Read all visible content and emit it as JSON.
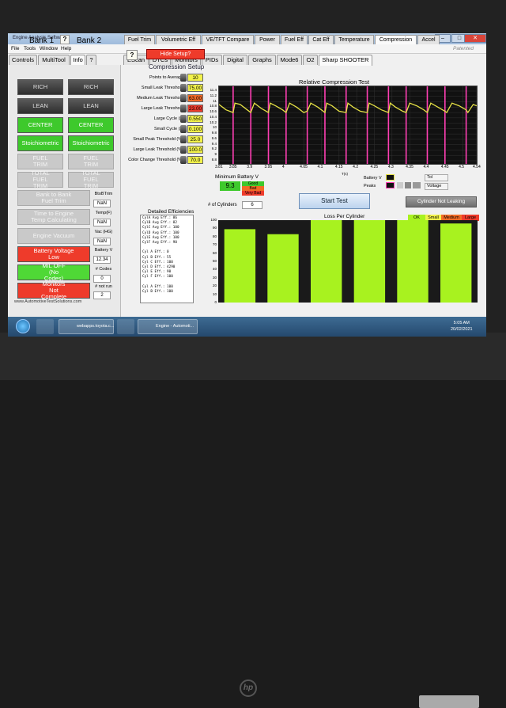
{
  "window": {
    "title": "Engine Analysis Software",
    "minimize": "–",
    "maximize": "□",
    "close": "✕",
    "menu": [
      "File",
      "Tools",
      "Window",
      "Help"
    ],
    "watermark": "Patented"
  },
  "main_tabs": [
    "Controls",
    "MultiTool",
    "Info",
    "?",
    "EScan",
    "DTCs",
    "Monitors",
    "PIDs",
    "Digital",
    "Graphs",
    "Mode6",
    "O2",
    "Sharp SHOOTER"
  ],
  "sub_tabs": [
    "Fuel Trim",
    "Volumetric Eff",
    "VE/TFT Compare",
    "Power",
    "Fuel Eff",
    "Cat Eff",
    "Temperature",
    "Compression",
    "Accel"
  ],
  "left": {
    "bank1": "Bank 1",
    "bank2": "Bank 2",
    "q": "?",
    "rich": "RICH",
    "lean": "LEAN",
    "center": "CENTER",
    "stoich": "Stoichiometric",
    "fuel_trim": "FUEL TRIM",
    "total_fuel_trim": "TOTAL FUEL TRIM",
    "bank_to_bank": "Bank to Bank Fuel Trim",
    "time_to_engine": "Time to Engine Temp Calculating",
    "engine_vacuum": "Engine Vacuum",
    "battery_voltage": "Battery Voltage Low",
    "mil_off": "MIL OFF (No Codes)",
    "monitors": "Monitors Not Complete",
    "url": "www.AutomotiveTestSolutions.com",
    "side": [
      {
        "label": "BtoBTrim",
        "value": "NaN"
      },
      {
        "label": "Temp(F)",
        "value": "NaN"
      },
      {
        "label": "Vac (HG)",
        "value": "NaN"
      },
      {
        "label": "Battery V",
        "value": "12.34"
      },
      {
        "label": "# Codes",
        "value": "0"
      },
      {
        "label": "# not run",
        "value": "2"
      }
    ]
  },
  "setup": {
    "q": "?",
    "hide": "Hide Setup?",
    "title": "Compression Setup",
    "rows": [
      {
        "label": "Points to Average",
        "value": "10",
        "color": "#f2f24a"
      },
      {
        "label": "Small Leak Threshold",
        "value": "75.00",
        "color": "#f2f24a"
      },
      {
        "label": "Medium Leak Threshold",
        "value": "63.00",
        "color": "#f26b26"
      },
      {
        "label": "Large Leak Threshold",
        "value": "23.00",
        "color": "#ee3b2b"
      },
      {
        "label": "Large Cycle (s)",
        "value": "0.550",
        "color": "#f2f24a"
      },
      {
        "label": "Small Cycle (s)",
        "value": "0.100",
        "color": "#f2f24a"
      },
      {
        "label": "Small Peak Threshold (%)",
        "value": "25.0",
        "color": "#f2f24a"
      },
      {
        "label": "Large Leak Threshold (%)",
        "value": "100.0",
        "color": "#f2f24a"
      },
      {
        "label": "Color Change Threshold (%)",
        "value": "70.0",
        "color": "#f2f24a"
      }
    ]
  },
  "chart_data": [
    {
      "type": "line",
      "title": "Relative Compression Test",
      "xlabel": "T(s)",
      "x_ticks": [
        "3.81",
        "3.85",
        "3.9",
        "3.95",
        "4",
        "4.05",
        "4.1",
        "4.15",
        "4.2",
        "4.25",
        "4.3",
        "4.35",
        "4.4",
        "4.45",
        "4.5",
        "4.54"
      ],
      "y_ticks": [
        "11.4",
        "11.2",
        "11",
        "10.8",
        "10.6",
        "10.4",
        "10.2",
        "10",
        "9.8",
        "9.6",
        "9.4",
        "9.2",
        "9",
        "8.8"
      ],
      "ylim": [
        8.8,
        11.4
      ],
      "xlim": [
        3.81,
        4.54
      ],
      "trace_color": "#e5e045",
      "marker_color": "#ff3fb4",
      "peak_markers": [
        3.85,
        3.9,
        3.95,
        4.0,
        4.06,
        4.11,
        4.17,
        4.23,
        4.29,
        4.34,
        4.4,
        4.45,
        4.51
      ],
      "trace_x": [
        3.81,
        3.83,
        3.85,
        3.855,
        3.87,
        3.89,
        3.9,
        3.91,
        3.93,
        3.95,
        3.955,
        3.97,
        3.99,
        4.0,
        4.01,
        4.03,
        4.05,
        4.06,
        4.07,
        4.09,
        4.11,
        4.115,
        4.13,
        4.15,
        4.17,
        4.175,
        4.19,
        4.21,
        4.23,
        4.235,
        4.25,
        4.27,
        4.29,
        4.295,
        4.31,
        4.33,
        4.34,
        4.35,
        4.37,
        4.39,
        4.4,
        4.41,
        4.43,
        4.45,
        4.455,
        4.47,
        4.49,
        4.51,
        4.515,
        4.53,
        4.54
      ],
      "trace_y": [
        10.9,
        10.7,
        10.6,
        10.95,
        10.9,
        10.7,
        10.6,
        10.95,
        10.75,
        10.6,
        10.95,
        10.85,
        10.7,
        10.6,
        10.95,
        10.8,
        10.6,
        10.65,
        10.95,
        10.8,
        10.6,
        10.95,
        10.85,
        10.65,
        10.6,
        10.95,
        10.8,
        10.65,
        10.6,
        10.95,
        10.85,
        10.7,
        10.6,
        10.95,
        10.8,
        10.65,
        10.6,
        10.95,
        10.85,
        10.7,
        10.6,
        10.95,
        10.8,
        10.65,
        10.6,
        10.95,
        10.85,
        10.7,
        10.6,
        10.9,
        10.85
      ]
    },
    {
      "type": "bar",
      "title": "Loss Per Cylinder",
      "y_ticks": [
        "100",
        "90",
        "80",
        "70",
        "60",
        "50",
        "40",
        "30",
        "20",
        "10",
        "0"
      ],
      "ylim": [
        0,
        100
      ],
      "bar_color": "#a8f21f",
      "values": [
        89,
        83,
        100,
        100,
        100,
        96
      ],
      "legend": [
        {
          "label": "OK",
          "color": "#a8f21f"
        },
        {
          "label": "Small",
          "color": "#f2f24a"
        },
        {
          "label": "Medium",
          "color": "#f26b26"
        },
        {
          "label": "Large",
          "color": "#ee3b2b"
        }
      ]
    }
  ],
  "battery": {
    "label": "Minimum Battery V",
    "value": "9.3",
    "good": "Good",
    "bad": "Bad",
    "very_bad": "Very Bad"
  },
  "cylinders": {
    "label": "# of Cylinders",
    "value": "6"
  },
  "start_test": "Start Test",
  "cyl_status": "Cylinder Not Leaking",
  "right": {
    "battery_v": "Battery V",
    "peaks": "Peaks",
    "tol": "Tol",
    "voltage": "Voltage"
  },
  "efficiencies": {
    "title": "Detailed Efficiencies",
    "lines": [
      "CylA Avg Eff.: 86",
      "CylB Avg Eff.: 82",
      "CylC Avg Eff.: 100",
      "CylD Avg Eff.: 100",
      "CylE Avg Eff.: 100",
      "CylF Avg Eff.: 90",
      "",
      "Cyl A Eff.: 0",
      "Cyl B Eff.: 55",
      "Cyl C Eff.: 100",
      "Cyl D Eff.: 4290",
      "Cyl E Eff.: 90",
      "Cyl F Eff.: 100",
      "",
      "Cyl A Eff.: 100",
      "Cyl B Eff.: 100"
    ]
  },
  "taskbar": {
    "app1": "webapps.toyota.c...",
    "app2": "Engine - Automoti...",
    "time": "5:05 AM",
    "date": "20/02/2021"
  },
  "bezel": {
    "logo": "hp"
  }
}
